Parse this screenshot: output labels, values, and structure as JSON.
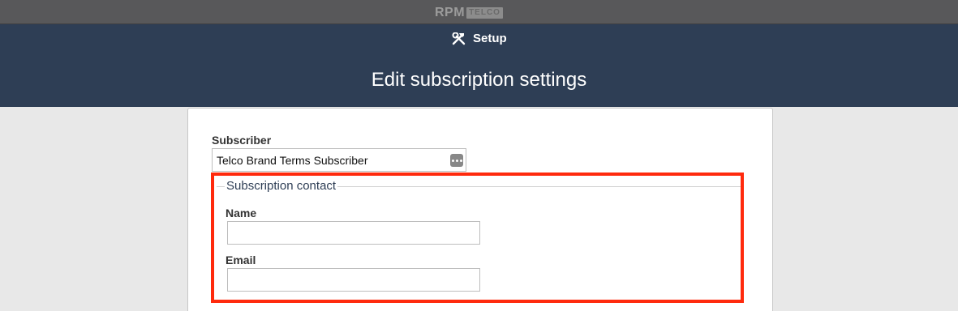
{
  "topbar": {
    "logo_main": "RPM",
    "logo_sub": "TELCO"
  },
  "header": {
    "setup_icon": "tools-icon",
    "setup_label": "Setup",
    "title": "Edit subscription settings"
  },
  "form": {
    "subscriber": {
      "label": "Subscriber",
      "value": "Telco Brand Terms Subscriber",
      "lookup_icon": "ellipsis-icon"
    },
    "contact_section": {
      "legend": "Subscription contact",
      "name_label": "Name",
      "name_value": "",
      "email_label": "Email",
      "email_value": ""
    }
  },
  "colors": {
    "topbar": "#58585a",
    "header": "#2e3e55",
    "highlight": "#ff2a0d",
    "background": "#e8e8e8"
  }
}
